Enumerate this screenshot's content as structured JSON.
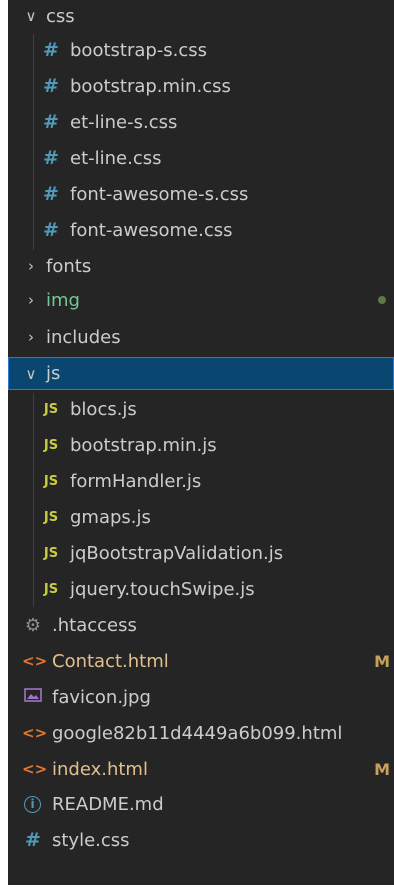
{
  "explorer": {
    "css_folder": {
      "label": "css",
      "chevron": "expanded"
    },
    "css_files": [
      {
        "label": "bootstrap-s.css",
        "icon": "hash-icon"
      },
      {
        "label": "bootstrap.min.css",
        "icon": "hash-icon"
      },
      {
        "label": "et-line-s.css",
        "icon": "hash-icon"
      },
      {
        "label": "et-line.css",
        "icon": "hash-icon"
      },
      {
        "label": "font-awesome-s.css",
        "icon": "hash-icon"
      },
      {
        "label": "font-awesome.css",
        "icon": "hash-icon"
      }
    ],
    "folders": [
      {
        "label": "fonts",
        "chevron": "collapsed"
      },
      {
        "label": "img",
        "chevron": "collapsed",
        "status": "untracked"
      },
      {
        "label": "includes",
        "chevron": "collapsed"
      }
    ],
    "js_folder": {
      "label": "js",
      "chevron": "expanded",
      "selected": true
    },
    "js_files": [
      {
        "label": "blocs.js",
        "icon_text": "JS"
      },
      {
        "label": "bootstrap.min.js",
        "icon_text": "JS"
      },
      {
        "label": "formHandler.js",
        "icon_text": "JS"
      },
      {
        "label": "gmaps.js",
        "icon_text": "JS"
      },
      {
        "label": "jqBootstrapValidation.js",
        "icon_text": "JS"
      },
      {
        "label": "jquery.touchSwipe.js",
        "icon_text": "JS"
      }
    ],
    "root_files": [
      {
        "label": ".htaccess",
        "icon": "gear-icon"
      },
      {
        "label": "Contact.html",
        "icon": "html-icon",
        "badge": "M"
      },
      {
        "label": "favicon.jpg",
        "icon": "image-icon"
      },
      {
        "label": "google82b11d4449a6b099.html",
        "icon": "html-icon"
      },
      {
        "label": "index.html",
        "icon": "html-icon",
        "badge": "M"
      },
      {
        "label": "README.md",
        "icon": "info-icon",
        "icon_text": "i"
      },
      {
        "label": "style.css",
        "icon": "hash-icon"
      }
    ],
    "colors": {
      "background": "#252526",
      "selected": "#094771",
      "modified": "#e2c08d",
      "untracked": "#73c991",
      "css_icon": "#519aba",
      "js_icon": "#cbcb41",
      "html_icon": "#e37933"
    }
  }
}
